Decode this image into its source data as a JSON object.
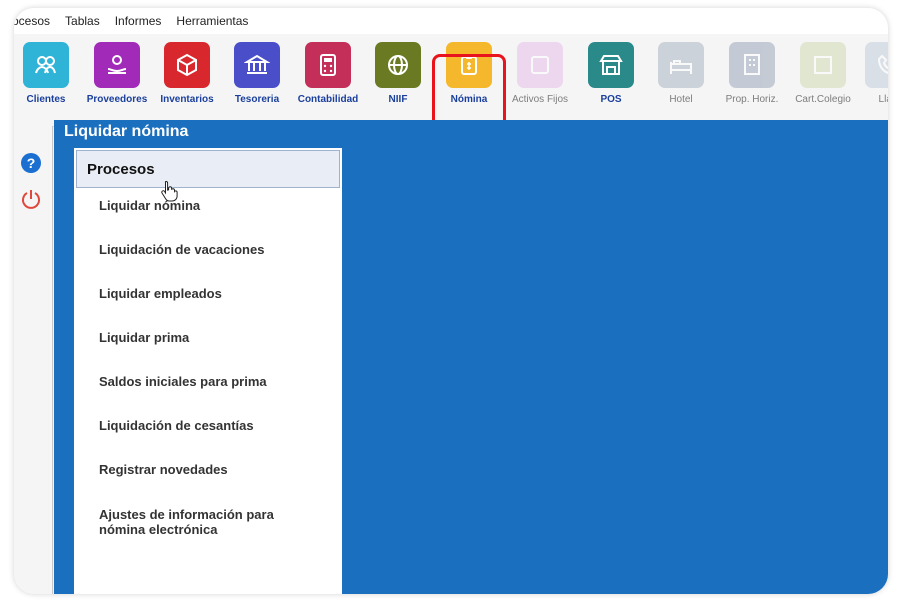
{
  "menubar": {
    "items": [
      "ocesos",
      "Tablas",
      "Informes",
      "Herramientas"
    ]
  },
  "toolbar": {
    "buttons": [
      {
        "label": "Clientes",
        "icon": "clients-icon",
        "color": "#2fb3d6",
        "enabled": true
      },
      {
        "label": "Proveedores",
        "icon": "suppliers-icon",
        "color": "#a12bb8",
        "enabled": true
      },
      {
        "label": "Inventarios",
        "icon": "inventory-icon",
        "color": "#d8282e",
        "enabled": true
      },
      {
        "label": "Tesoreria",
        "icon": "treasury-icon",
        "color": "#4a4fc9",
        "enabled": true
      },
      {
        "label": "Contabilidad",
        "icon": "accounting-icon",
        "color": "#c42f5a",
        "enabled": true
      },
      {
        "label": "NIIF",
        "icon": "globe-icon",
        "color": "#6a7a22",
        "enabled": true
      },
      {
        "label": "Nómina",
        "icon": "payroll-icon",
        "color": "#f5b72b",
        "enabled": true
      },
      {
        "label": "Activos Fijos",
        "icon": "fixed-assets-icon",
        "color": "#e2b3e6",
        "enabled": false
      },
      {
        "label": "POS",
        "icon": "pos-icon",
        "color": "#2a8a8a",
        "enabled": true
      },
      {
        "label": "Hotel",
        "icon": "hotel-icon",
        "color": "#9aa8b8",
        "enabled": false
      },
      {
        "label": "Prop. Horiz.",
        "icon": "building-icon",
        "color": "#8a98b0",
        "enabled": false
      },
      {
        "label": "Cart.Colegio",
        "icon": "school-icon",
        "color": "#c9d4a4",
        "enabled": false
      },
      {
        "label": "Llan",
        "icon": "phone-icon",
        "color": "#b8c6d6",
        "enabled": false
      }
    ]
  },
  "main": {
    "title": "Liquidar nómina",
    "panel": {
      "header": "Procesos",
      "items": [
        "Liquidar nómina",
        "Liquidación de vacaciones",
        "Liquidar empleados",
        "Liquidar prima",
        "Saldos iniciales para prima",
        "Liquidación de cesantías",
        "Registrar novedades",
        "Ajustes de información para nómina electrónica"
      ]
    }
  },
  "colors": {
    "main_bg": "#1a6fbf",
    "highlight": "#e8131c",
    "toolbar_label": "#1a3f9c"
  }
}
